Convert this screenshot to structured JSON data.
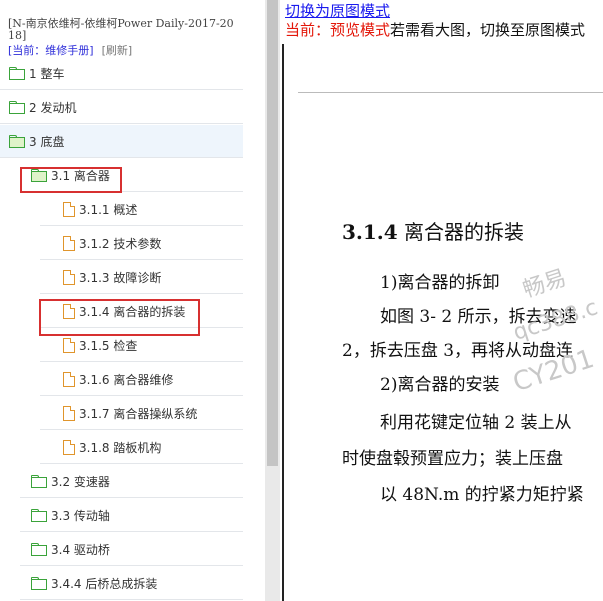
{
  "left_panel": {
    "doc_title": "[N-南京依维柯-依维柯Power Daily-2017-2018]",
    "mode_prefix": "[当前：维修手册]",
    "refresh": "[刷新]",
    "items": [
      {
        "label": "1 整车",
        "icon": "folder-icon"
      },
      {
        "label": "2 发动机",
        "icon": "folder-icon"
      },
      {
        "label": "3 底盘",
        "icon": "folder-open-icon"
      },
      {
        "label": "3.1 离合器",
        "icon": "folder-open-icon"
      },
      {
        "label": "3.1.1 概述",
        "icon": "document-icon"
      },
      {
        "label": "3.1.2 技术参数",
        "icon": "document-icon"
      },
      {
        "label": "3.1.3 故障诊断",
        "icon": "document-icon"
      },
      {
        "label": "3.1.4 离合器的拆装",
        "icon": "document-icon"
      },
      {
        "label": "3.1.5 检查",
        "icon": "document-icon"
      },
      {
        "label": "3.1.6 离合器维修",
        "icon": "document-icon"
      },
      {
        "label": "3.1.7 离合器操纵系统",
        "icon": "document-icon"
      },
      {
        "label": "3.1.8 踏板机构",
        "icon": "document-icon"
      },
      {
        "label": "3.2 变速器",
        "icon": "folder-icon"
      },
      {
        "label": "3.3 传动轴",
        "icon": "folder-icon"
      },
      {
        "label": "3.4 驱动桥",
        "icon": "folder-icon"
      },
      {
        "label": "3.4.4 后桥总成拆装",
        "icon": "folder-icon"
      }
    ]
  },
  "preview": {
    "toggle_link": "切换为原图模式",
    "mode_current": "当前：预览模式",
    "mode_hint": "若需看大图，切换至原图模式",
    "section_number": "3.1.4",
    "section_title": "离合器的拆装",
    "lines": [
      "1)离合器的拆卸",
      "如图 3- 2 所示，拆去变速",
      "2，拆去压盘 3，再将从动盘连",
      "2)离合器的安装",
      "利用花键定位轴 2 装上从",
      "时使盘毂预置应力；装上压盘",
      "以 48N.m 的拧紧力矩拧紧"
    ],
    "watermark": [
      "畅易",
      "qc388.c",
      "CY201"
    ]
  },
  "colors": {
    "link": "#1a1aee",
    "preview_red": "#e3170a",
    "highlight_box": "#d73030",
    "folder": "#3aa33a",
    "document": "#e0952c",
    "selected_row": "#eef5fc"
  }
}
